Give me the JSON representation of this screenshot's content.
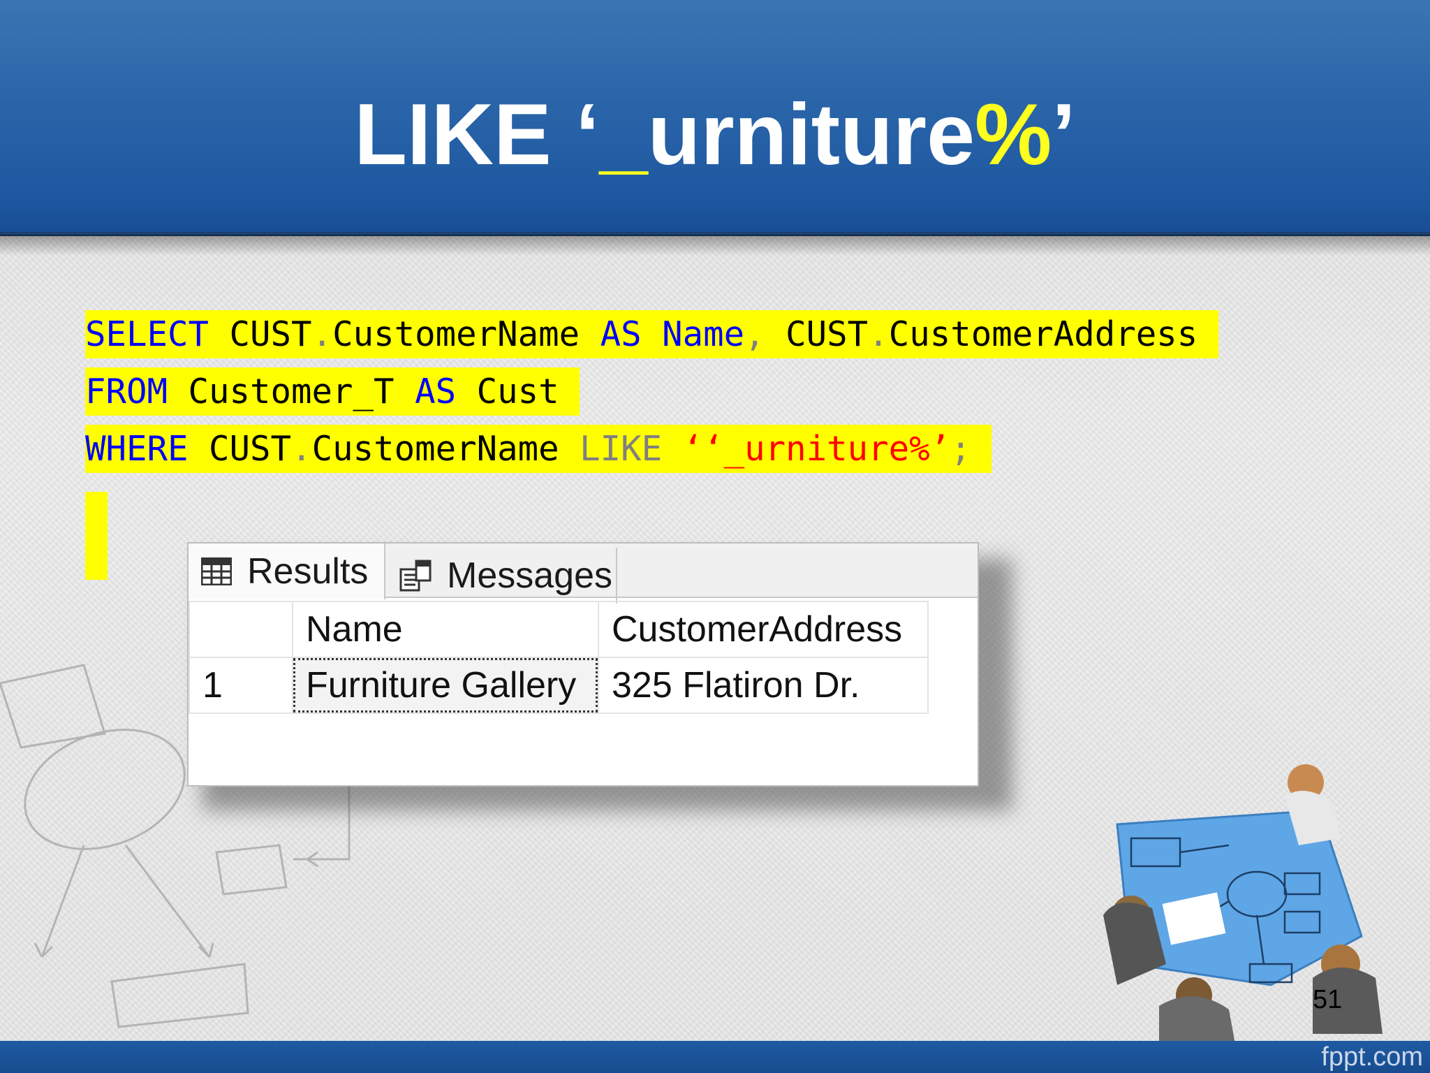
{
  "slide": {
    "title_parts": [
      "LIKE ‘",
      "_",
      "urniture",
      "%",
      "’"
    ],
    "page_number": "51",
    "brand": "fppt.com"
  },
  "sql": {
    "line1": {
      "select": "SELECT",
      "cust1": "CUST",
      "dot1": ".",
      "name_col": "CustomerName",
      "as1": "AS",
      "alias": "Name",
      "comma": ",",
      "cust2": "CUST",
      "dot2": ".",
      "addr_col": "CustomerAddress"
    },
    "line2": {
      "from": "FROM",
      "table": "Customer_T",
      "as2": "AS",
      "alias2": "Cust"
    },
    "line3": {
      "where": "WHERE",
      "cust3": "CUST",
      "dot3": ".",
      "name_col": "CustomerName",
      "like": "LIKE",
      "pattern": "‘‘_urniture%’",
      "semicolon": ";"
    }
  },
  "results_panel": {
    "tabs": [
      {
        "label": "Results",
        "icon": "grid-icon"
      },
      {
        "label": "Messages",
        "icon": "messages-icon"
      }
    ],
    "columns": [
      "Name",
      "CustomerAddress"
    ],
    "rows": [
      {
        "num": "1",
        "name": "Furniture Gallery",
        "address": "325 Flatiron Dr."
      }
    ]
  },
  "colors": {
    "header_blue": "#2a64a8",
    "highlight_yellow": "#ffff00",
    "keyword_blue": "#0000ff",
    "string_red": "#ff0000"
  }
}
